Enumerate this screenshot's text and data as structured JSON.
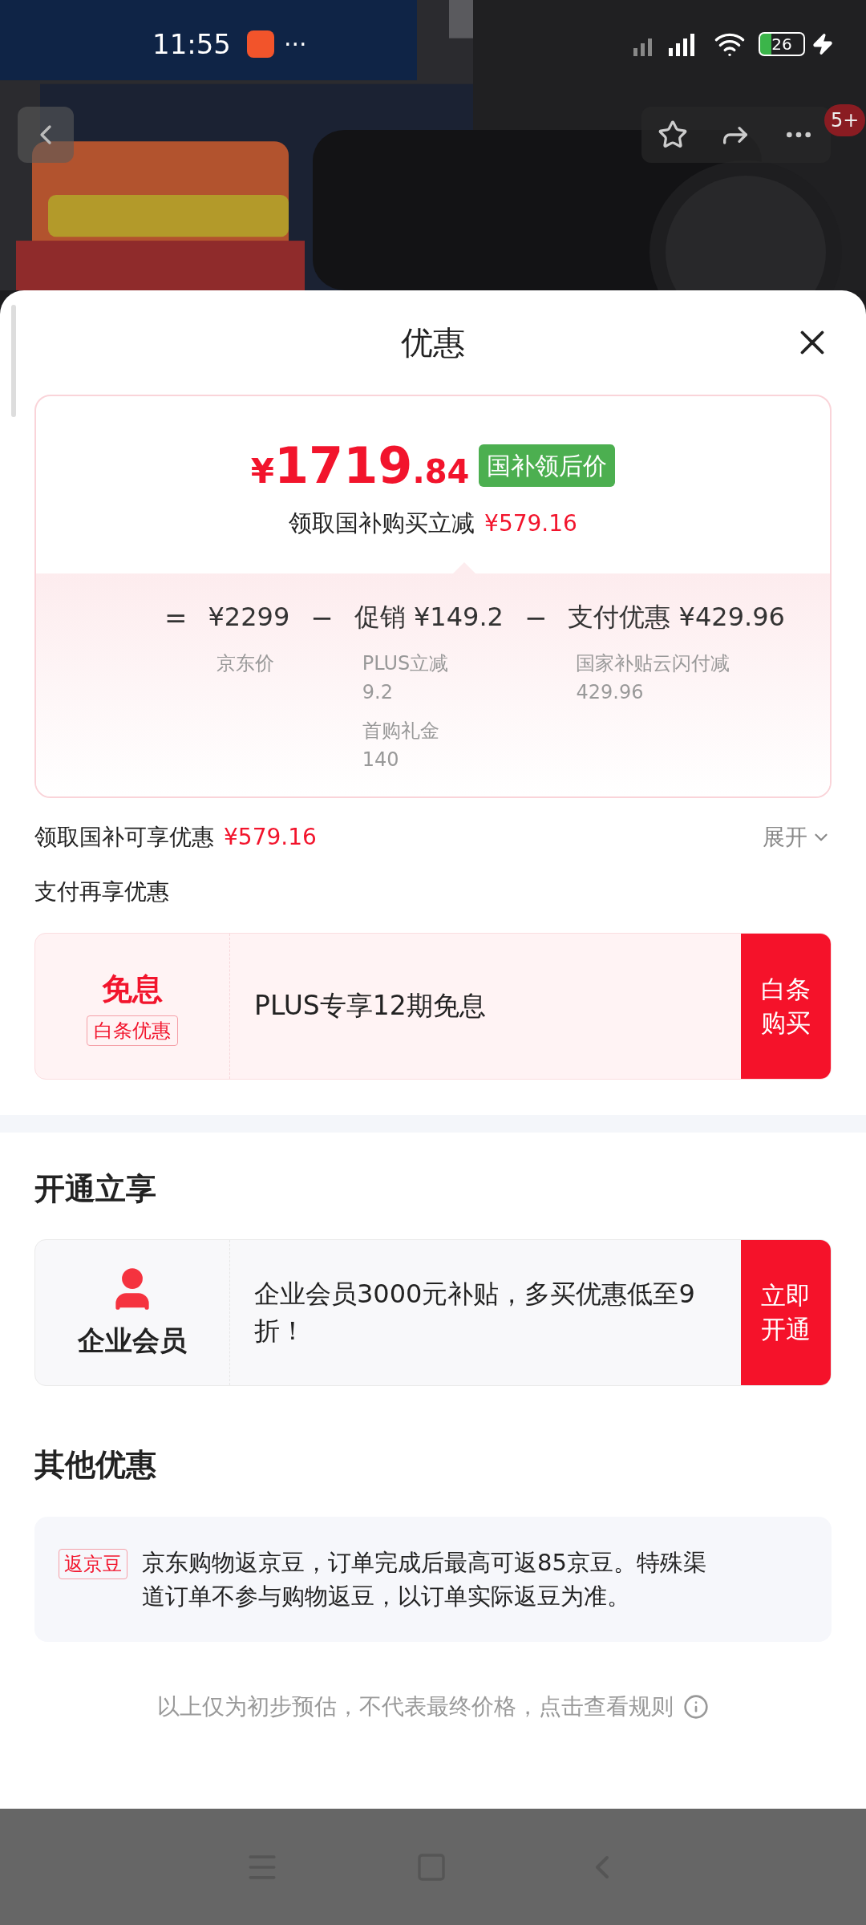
{
  "status_bar": {
    "time": "11:55",
    "notification_more": "···",
    "battery": "26"
  },
  "top_bar": {
    "badge": "5+"
  },
  "sheet": {
    "title": "优惠"
  },
  "price": {
    "symbol": "¥",
    "integer": "1719",
    "decimal": ".84",
    "tag": "国补领后价",
    "subtitle": "领取国补购买立减",
    "subtitle_amount": "¥579.16"
  },
  "breakdown": [
    {
      "operator": "=",
      "amount": "¥2299",
      "details": [
        {
          "label": "京东价"
        }
      ]
    },
    {
      "operator": "−",
      "name": "促销",
      "amount": "¥149.2",
      "details": [
        {
          "label": "PLUS立减",
          "value": "9.2"
        },
        {
          "label": "首购礼金",
          "value": "140"
        }
      ]
    },
    {
      "operator": "−",
      "name": "支付优惠",
      "amount": "¥429.96",
      "details": [
        {
          "label": "国家补贴云闪付减",
          "value": "429.96"
        }
      ]
    }
  ],
  "subsidy": {
    "label": "领取国补可享优惠",
    "amount": "¥579.16",
    "toggle": "展开",
    "expanded": false
  },
  "pay_section": {
    "title": "支付再享优惠",
    "offer": {
      "headline": "免息",
      "tag": "白条优惠",
      "text": "PLUS专享12期免息",
      "action": "白条购买"
    }
  },
  "membership": {
    "title": "开通立享",
    "card": {
      "name": "企业会员",
      "text": "企业会员3000元补贴，多买优惠低至9折！",
      "action": "立即开通"
    }
  },
  "other": {
    "title": "其他优惠",
    "items": [
      {
        "tag": "返京豆",
        "text": "京东购物返京豆，订单完成后最高可返85京豆。特殊渠道订单不参与购物返豆，以订单实际返豆为准。"
      }
    ]
  },
  "footer": {
    "text": "以上仅为初步预估，不代表最终价格，点击查看规则"
  }
}
